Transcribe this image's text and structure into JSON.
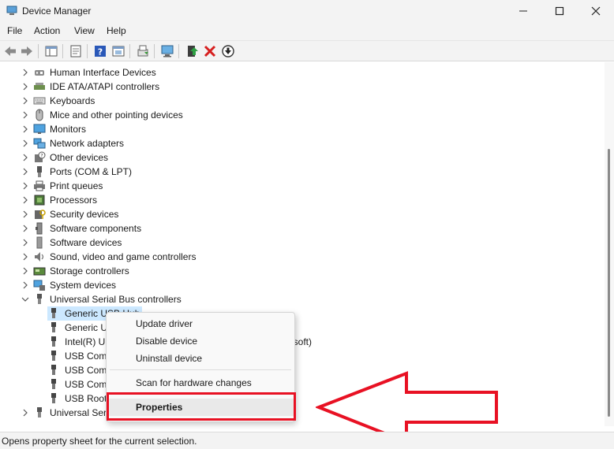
{
  "window": {
    "title": "Device Manager",
    "icon": "device-manager-icon",
    "controls": [
      "minimize-icon",
      "maximize-icon",
      "close-icon"
    ]
  },
  "menu": [
    "File",
    "Action",
    "View",
    "Help"
  ],
  "toolbar": [
    "back-icon",
    "forward-icon",
    "show-hide-console-tree-icon",
    "properties-icon",
    "help-icon",
    "refresh-view-icon",
    "export-list-icon",
    "scan-hardware-icon",
    "update-driver-icon",
    "uninstall-device-icon",
    "disable-device-icon"
  ],
  "tree": [
    {
      "label": "Human Interface Devices",
      "icon": "hid-icon",
      "expanded": false
    },
    {
      "label": "IDE ATA/ATAPI controllers",
      "icon": "ide-controller-icon",
      "expanded": false
    },
    {
      "label": "Keyboards",
      "icon": "keyboard-icon",
      "expanded": false
    },
    {
      "label": "Mice and other pointing devices",
      "icon": "mouse-icon",
      "expanded": false
    },
    {
      "label": "Monitors",
      "icon": "monitor-icon",
      "expanded": false
    },
    {
      "label": "Network adapters",
      "icon": "network-adapter-icon",
      "expanded": false
    },
    {
      "label": "Other devices",
      "icon": "other-devices-icon",
      "expanded": false
    },
    {
      "label": "Ports (COM & LPT)",
      "icon": "port-icon",
      "expanded": false
    },
    {
      "label": "Print queues",
      "icon": "printer-icon",
      "expanded": false
    },
    {
      "label": "Processors",
      "icon": "processor-icon",
      "expanded": false
    },
    {
      "label": "Security devices",
      "icon": "security-device-icon",
      "expanded": false
    },
    {
      "label": "Software components",
      "icon": "software-component-icon",
      "expanded": false
    },
    {
      "label": "Software devices",
      "icon": "software-device-icon",
      "expanded": false
    },
    {
      "label": "Sound, video and game controllers",
      "icon": "speaker-icon",
      "expanded": false
    },
    {
      "label": "Storage controllers",
      "icon": "storage-controller-icon",
      "expanded": false
    },
    {
      "label": "System devices",
      "icon": "system-device-icon",
      "expanded": false
    },
    {
      "label": "Universal Serial Bus controllers",
      "icon": "usb-icon",
      "expanded": true
    },
    {
      "label": "Generic USB Hub",
      "icon": "usb-plug-icon",
      "child": true,
      "selected": true
    },
    {
      "label": "Generic U",
      "icon": "usb-plug-icon",
      "child": true
    },
    {
      "label": "Intel(R) US",
      "icon": "usb-plug-icon",
      "child": true,
      "tail": "osoft)"
    },
    {
      "label": "USB Comp",
      "icon": "usb-plug-icon",
      "child": true
    },
    {
      "label": "USB Comp",
      "icon": "usb-plug-icon",
      "child": true
    },
    {
      "label": "USB Comp",
      "icon": "usb-plug-icon",
      "child": true
    },
    {
      "label": "USB Root",
      "icon": "usb-plug-icon",
      "child": true
    },
    {
      "label": "Universal Seri",
      "icon": "usb-icon",
      "expanded": false
    }
  ],
  "context_menu": {
    "items": [
      {
        "label": "Update driver"
      },
      {
        "label": "Disable device"
      },
      {
        "label": "Uninstall device"
      },
      {
        "separator": true
      },
      {
        "label": "Scan for hardware changes"
      },
      {
        "separator": true
      },
      {
        "label": "Properties",
        "bold": true
      }
    ]
  },
  "status_text": "Opens property sheet for the current selection.",
  "colors": {
    "selection": "#cce8ff",
    "annotation": "#e81123",
    "chrome": "#f3f3f3"
  }
}
